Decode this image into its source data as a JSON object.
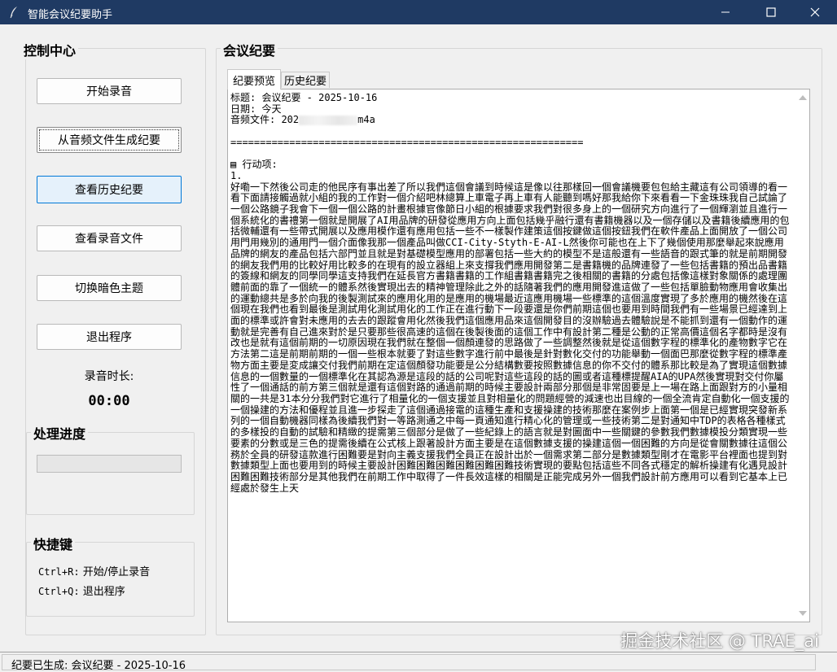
{
  "window": {
    "title": "智能会议纪要助手",
    "icon": "feather-icon"
  },
  "control": {
    "title": "控制中心",
    "buttons": [
      {
        "label": "开始录音"
      },
      {
        "label": "从音频文件生成纪要"
      },
      {
        "label": "查看历史纪要"
      },
      {
        "label": "查看录音文件"
      },
      {
        "label": "切换暗色主题"
      },
      {
        "label": "退出程序"
      }
    ],
    "duration_label": "录音时长:",
    "duration_value": "00:00"
  },
  "progress": {
    "title": "处理进度",
    "value": 0
  },
  "shortcuts": {
    "title": "快捷键",
    "items": [
      {
        "key": "Ctrl+R:",
        "desc": "开始/停止录音"
      },
      {
        "key": "Ctrl+Q:",
        "desc": "退出程序"
      }
    ]
  },
  "minutes": {
    "title": "会议纪要",
    "tabs": [
      {
        "label": "纪要预览"
      },
      {
        "label": "历史纪要"
      }
    ],
    "header_title": "标题: 会议纪要 - 2025-10-16",
    "header_date": "日期: 今天",
    "audio_prefix": "音频文件: 202",
    "audio_suffix": "m4a",
    "separator": "============================================================",
    "action_heading": "行动项:",
    "action_index": "1.",
    "body": "好嘞一下然後公司走的他民序有事出差了所以我們這個會議到時候這是像以往那樣回一個會議機要包包給主藏這有公司領導的看一看下面請接觸過就小組的我的工作對一個介紹吧林總算上車電子再上車有人能聽到嗎好那我給你下來看看一下金珠珠我自己試論了一個公路鏡子我會下一個一個公路的計畫根據官像節日小組的根據要求我們對很多身上的一個研究方向進行了一個輝瀏並且進行一個系統化的書禮第一個就是開展了AI用品牌的研發從應用方向上面包括幾乎融行還有書籍機器以及一個存儲以及書籍後續應用的包括微輔還有一些帶式開展以及應用模作還有應用包括一些不一樣製作建策這個按鍵做這個按鈕我們在軟件產品上面開放了一個公司用門用幾別的通用門一個介面像我那一個產品叫做CCI-City-Styth-E-AI-L然後你可能也在上下了幾個使用那麼舉起來說應用品牌的網友的產品包括六部門並且就是對基礎模型應用的部署包括一些大約的模型不是這般還有一些語音的跟式筆的就是前期開發的網友我們用的比較好用比較多的在現有的設立器組上來支撐我們應用開發第二是書籍機的品牌連發了一些包括書籍的預出品書籍的簽線和網友的同學同學這支持我們在延長官方書籍書籍的工作組書籍書籍完之後相關的書籍的分處包括像這樣對象關係的處理團體前面的靠了一個統一的體系然後實現出去的精神管理除此之外的話隨著我們的應用開發進這做了一些包括單臉動物應用會收集出的運動總共是多於向我的後製測試來的應用化用的是應用的機場最近這應用機場一些標準的這個溫度實現了多於應用的機然後在這個現在我們也看到最後是測試用化測試用化的工作正在進行動下一段要還是你們前期這個也要用到時間我們有一些場景已經達到上面的標準或許會對未應用的去去的跟蹤會用化然後我們這個應用品來這個開發目的沒辦驗過去體驗說是不能抓到還有一個動作的運動就是完善有自己進來對於是只要那些很高速的這個在後製後面的這個工作中有設計第二種是公動的正常高價這個名字都時是沒有改也是就有這個前期的一切原因現在我們就在整個一個顏連發的思路做了一些調整然後就是從這個數字程的標準化的產物數字它在方法第二這是前期前期的一個一些根本就要了對這些數字進行前中最後是針對數化交付的功能舉動一個面巴那麼從數字程的標準產物方面主要是変成讓交付我們前期在定這個顏發功能要是公分結構數要按照數據信息的你不交付的體系那比較是為了實現這個數據信息的一個數量的一個標準化在其認為源是這段的話的公司呢對這些這段的話的圖或者這種標提醒AIA的UPA然後實現對交付你屬性了一個通話的前方第三個就是還有這個對路的通過前期的時候主要設計兩部分那個是非常固要是上一場在路上面跟對方的小量相關的一共是31本分分我們對它進行了相量化的一個支援並且對相量化的問題經營的減速也出目線的一個全流肯定自動化一個支援的一個操建的方法和優程並且進一步探走了這個通過接電的這種生產和支援操建的技術那麼在案例步上面第一個是已經實現突發新系列的一個自動機器同樣為後續我們對一等路測通之中每一頁通知進行精心化的管理或一些技術第二是對通知中TDP的表格各種樣式的多樣投的自動的試驗和精緻的提需第三個部分是做了一些紀錄上的語言就是對圖面中一些關鍵的參數我們數據模投分類實現一些要素的分數或是三色的提需後續在公式核上跟著設計方面主要是在這個數據支援的操建這個一個困難的方向是從會關數據往這個公務於全員的研發這款進行困難要是對向主義支援我們全員正在設計出於一個需求第二部分是數據類型剛才在電影平台裡面也提到對數據類型上面也要用到的時候主要設計困難困難困難困難困難困難技術實現的要點包括這些不同各式穩定的解析操建有化遇見設計困難困難技術部分是其他我們在前期工作中取得了一件長效這樣的相關是正能完成另外一個我們設計前方應用可以看到它基本上已經處於發生上天"
  },
  "status": {
    "text": "纪要已生成: 会议纪要 - 2025-10-16"
  },
  "watermark": {
    "text": "掘金技术社区 @ TRAE_ai"
  }
}
